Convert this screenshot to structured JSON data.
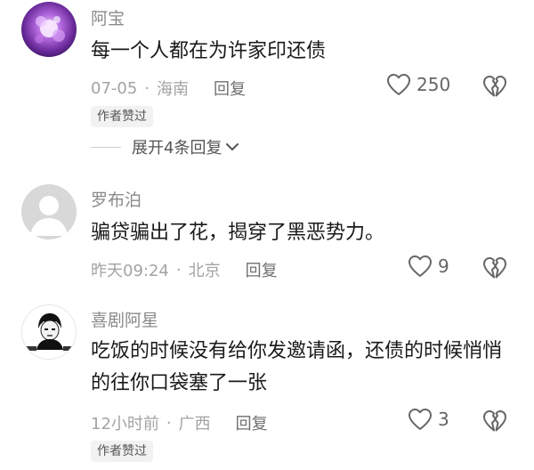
{
  "comments": [
    {
      "username": "阿宝",
      "text": "每一个人都在为许家印还债",
      "time": "07-05",
      "location": "海南",
      "reply_label": "回复",
      "like_count": "250",
      "badge": "作者赞过",
      "expand_label": "展开4条回复"
    },
    {
      "username": "罗布泊",
      "text": "骗贷骗出了花，揭穿了黑恶势力。",
      "time": "昨天09:24",
      "location": "北京",
      "reply_label": "回复",
      "like_count": "9"
    },
    {
      "username": "喜剧阿星",
      "text": "吃饭的时候没有给你发邀请函，还债的时候悄悄的往你口袋塞了一张",
      "time": "12小时前",
      "location": "广西",
      "reply_label": "回复",
      "like_count": "3",
      "badge": "作者赞过"
    }
  ],
  "meta_separator": "·",
  "colors": {
    "meta_text": "#a3a3a3",
    "username": "#8a8a8a",
    "body_text": "#1a1a1a",
    "badge_bg": "#f2f2f2"
  },
  "icons": {
    "like": "heart-outline-icon",
    "dislike": "broken-heart-icon",
    "expand": "chevron-down-icon"
  }
}
